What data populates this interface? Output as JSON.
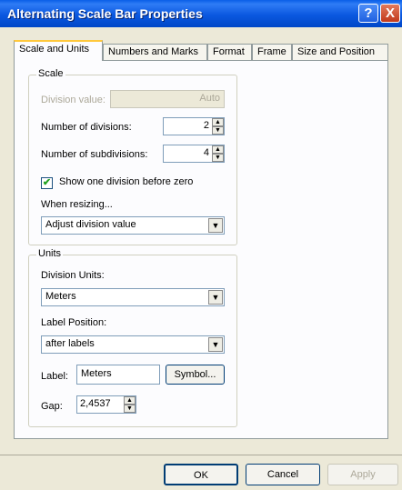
{
  "window": {
    "title": "Alternating Scale Bar Properties",
    "help": "?",
    "close": "X"
  },
  "tabs": [
    "Scale and Units",
    "Numbers and Marks",
    "Format",
    "Frame",
    "Size and Position"
  ],
  "scale": {
    "group_label": "Scale",
    "division_value_label": "Division value:",
    "division_value": "Auto",
    "num_divisions_label": "Number of divisions:",
    "num_divisions": "2",
    "num_subdivisions_label": "Number of subdivisions:",
    "num_subdivisions": "4",
    "show_one_division_label": "Show one division before zero",
    "show_one_division_checked": "✔",
    "when_resizing_label": "When resizing...",
    "when_resizing_value": "Adjust division value"
  },
  "units": {
    "group_label": "Units",
    "division_units_label": "Division Units:",
    "division_units_value": "Meters",
    "label_position_label": "Label Position:",
    "label_position_value": "after labels",
    "label_label": "Label:",
    "label_value": "Meters",
    "symbol_button": "Symbol...",
    "gap_label": "Gap:",
    "gap_value": "2,4537"
  },
  "buttons": {
    "ok": "OK",
    "cancel": "Cancel",
    "apply": "Apply"
  },
  "glyphs": {
    "up": "▲",
    "down": "▼",
    "dropdown": "▼"
  }
}
